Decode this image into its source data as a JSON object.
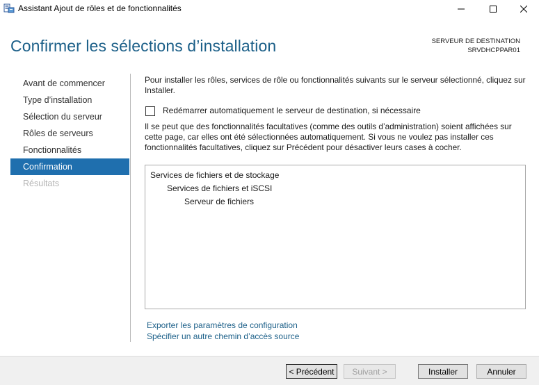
{
  "window": {
    "title": "Assistant Ajout de rôles et de fonctionnalités",
    "icon": "server-manager-icon"
  },
  "header": {
    "page_title": "Confirmer les sélections d’installation",
    "destination_label": "SERVEUR DE DESTINATION",
    "destination_server": "SRVDHCPPAR01"
  },
  "nav": {
    "items": [
      {
        "label": "Avant de commencer",
        "state": "normal"
      },
      {
        "label": "Type d’installation",
        "state": "normal"
      },
      {
        "label": "Sélection du serveur",
        "state": "normal"
      },
      {
        "label": "Rôles de serveurs",
        "state": "normal"
      },
      {
        "label": "Fonctionnalités",
        "state": "normal"
      },
      {
        "label": "Confirmation",
        "state": "active"
      },
      {
        "label": "Résultats",
        "state": "disabled"
      }
    ]
  },
  "content": {
    "intro": "Pour installer les rôles, services de rôle ou fonctionnalités suivants sur le serveur sélectionné, cliquez sur Installer.",
    "restart_checkbox": {
      "label": "Redémarrer automatiquement le serveur de destination, si nécessaire",
      "checked": false
    },
    "note": "Il se peut que des fonctionnalités facultatives (comme des outils d’administration) soient affichées sur cette page, car elles ont été sélectionnées automatiquement. Si vous ne voulez pas installer ces fonctionnalités facultatives, cliquez sur Précédent pour désactiver leurs cases à cocher.",
    "selections": [
      "Services de fichiers et de stockage",
      "Services de fichiers et iSCSI",
      "Serveur de fichiers"
    ],
    "link_export": "Exporter les paramètres de configuration",
    "link_source": "Spécifier un autre chemin d’accès source"
  },
  "footer": {
    "previous": "< Précédent",
    "next": "Suivant >",
    "install": "Installer",
    "cancel": "Annuler"
  },
  "colors": {
    "accent": "#1f6fae",
    "title": "#1b5f88"
  }
}
